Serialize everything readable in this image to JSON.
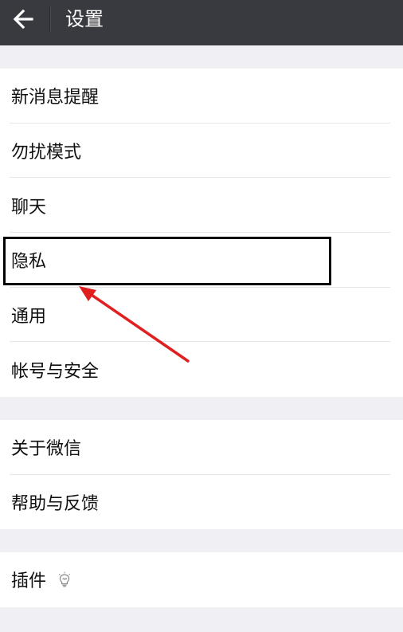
{
  "header": {
    "title": "设置",
    "back_icon": "arrow-left-icon"
  },
  "groups": [
    {
      "items": [
        {
          "label": "新消息提醒"
        },
        {
          "label": "勿扰模式"
        },
        {
          "label": "聊天"
        },
        {
          "label": "隐私"
        },
        {
          "label": "通用"
        },
        {
          "label": "帐号与安全"
        }
      ]
    },
    {
      "items": [
        {
          "label": "关于微信"
        },
        {
          "label": "帮助与反馈"
        }
      ]
    },
    {
      "items": [
        {
          "label": "插件",
          "icon": "plugin-bulb-icon"
        }
      ]
    }
  ],
  "annotation": {
    "highlighted_item": "隐私",
    "arrow_color": "#e02020",
    "box_color": "#000000"
  },
  "colors": {
    "topbar": "#393a3f",
    "background": "#efeff4",
    "row_bg": "#ffffff",
    "text": "#111111"
  }
}
